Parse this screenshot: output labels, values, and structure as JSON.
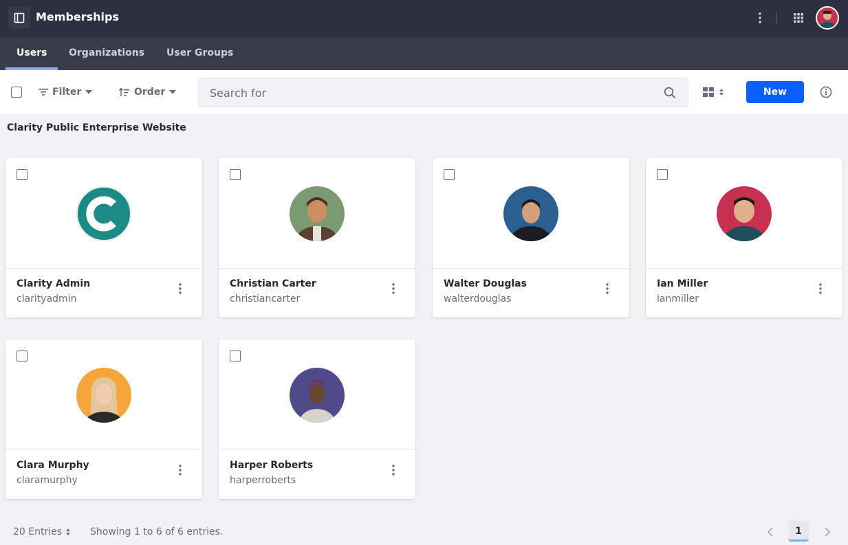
{
  "header": {
    "title": "Memberships",
    "panel_icon": "sidebar-panel-icon",
    "menu_icon": "vertical-ellipsis-icon",
    "apps_icon": "grid-apps-icon"
  },
  "tabs": [
    {
      "label": "Users",
      "active": true
    },
    {
      "label": "Organizations",
      "active": false
    },
    {
      "label": "User Groups",
      "active": false
    }
  ],
  "toolbar": {
    "filter_label": "Filter",
    "order_label": "Order",
    "search_placeholder": "Search for",
    "new_label": "New"
  },
  "section_title": "Clarity Public Enterprise Website",
  "users": [
    {
      "name": "Clarity Admin",
      "username": "clarityadmin",
      "avatar_color": "#1c8b86"
    },
    {
      "name": "Christian Carter",
      "username": "christiancarter",
      "avatar_color": "#7a9a72"
    },
    {
      "name": "Walter Douglas",
      "username": "walterdouglas",
      "avatar_color": "#2a5f8f"
    },
    {
      "name": "Ian Miller",
      "username": "ianmiller",
      "avatar_color": "#c8304f"
    },
    {
      "name": "Clara Murphy",
      "username": "claramurphy",
      "avatar_color": "#f5a53b"
    },
    {
      "name": "Harper Roberts",
      "username": "harperroberts",
      "avatar_color": "#4f4a8a"
    }
  ],
  "footer": {
    "entries_label": "20 Entries",
    "showing_text": "Showing 1 to 6 of 6 entries.",
    "current_page": "1"
  },
  "colors": {
    "header_bg": "#2e3041",
    "tab_bg": "#393a4a",
    "accent": "#0b5fff",
    "tab_indicator": "#80acff"
  }
}
